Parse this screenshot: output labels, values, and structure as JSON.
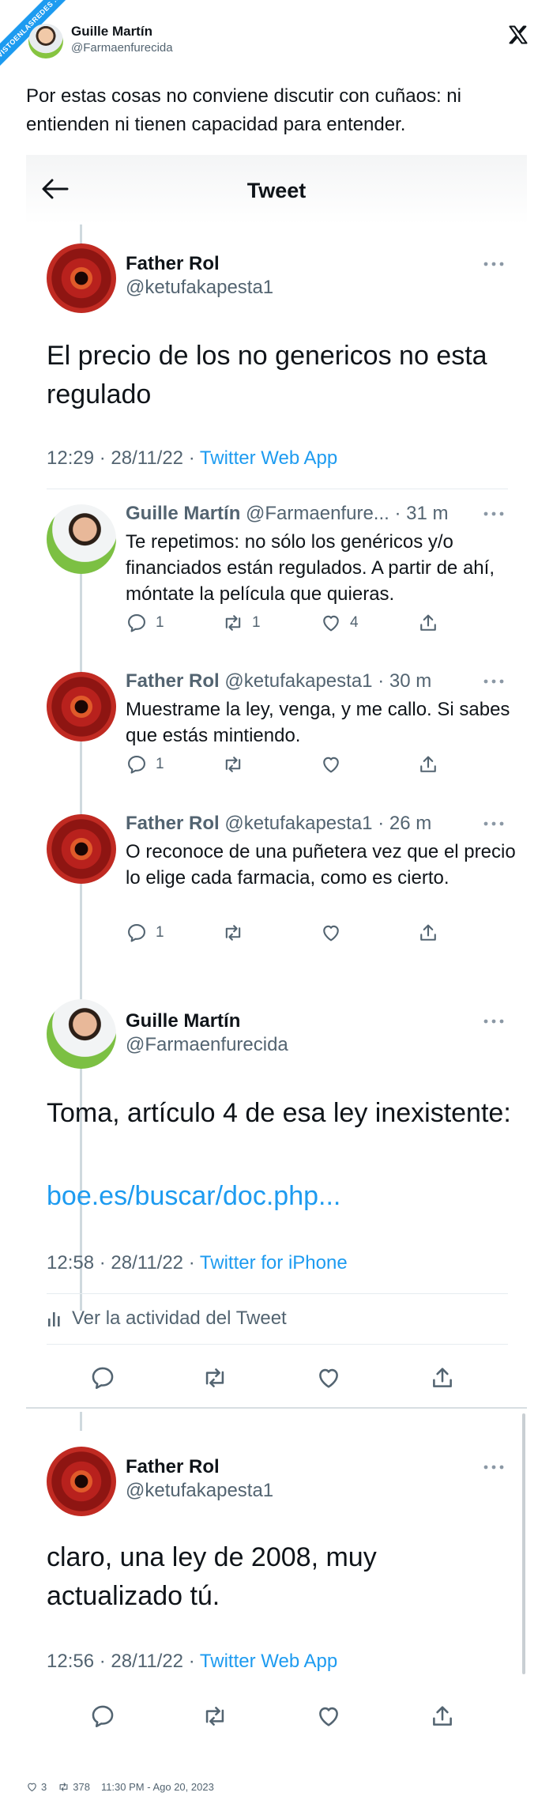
{
  "embed": {
    "ribbon_text": "VISTOENLASREDES .com",
    "author_name": "Guille Martín",
    "author_handle": "@Farmaenfurecida",
    "text": "Por estas cosas no conviene discutir con cuñaos: ni entienden ni tienen capacidad para entender.",
    "close_icon": "x-logo-icon"
  },
  "screenshot": {
    "header_title": "Tweet",
    "main_tweet": {
      "name": "Father Rol",
      "handle": "@ketufakapesta1",
      "text": "El precio de los no genericos no esta regulado",
      "time": "12:29 · 28/11/22 · ",
      "source": "Twitter Web App"
    },
    "replies": [
      {
        "name": "Guille Martín",
        "handle": "@Farmaenfure...",
        "age": "· 31 m",
        "text": "Te repetimos: no sólo los genéricos y/o financiados están regulados. A partir de ahí, móntate la película que quieras.",
        "reply_count": "1",
        "retweet_count": "1",
        "like_count": "4"
      },
      {
        "name": "Father Rol",
        "handle": "@ketufakapesta1",
        "age": "· 30 m",
        "text": "Muestrame la ley, venga, y me callo. Si sabes que estás mintiendo.",
        "reply_count": "1",
        "retweet_count": "",
        "like_count": ""
      },
      {
        "name": "Father Rol",
        "handle": "@ketufakapesta1",
        "age": "· 26 m",
        "text": "O reconoce de una puñetera vez que el precio lo elige cada farmacia, como es cierto.",
        "reply_count": "1",
        "retweet_count": "",
        "like_count": ""
      }
    ],
    "focus_tweet": {
      "name": "Guille Martín",
      "handle": "@Farmaenfurecida",
      "text": "Toma, artículo 4 de esa ley inexistente:",
      "link": "boe.es/buscar/doc.php...",
      "time": "12:58 · 28/11/22 · ",
      "source": "Twitter for iPhone",
      "activity_label": "Ver la actividad del Tweet"
    },
    "last_tweet": {
      "name": "Father Rol",
      "handle": "@ketufakapesta1",
      "text": "claro, una ley de 2008, muy actualizado tú.",
      "time": "12:56 · 28/11/22 · ",
      "source": "Twitter Web App"
    }
  },
  "footer": {
    "likes": "3",
    "retweets": "378",
    "timestamp": "11:30 PM - Ago 20, 2023"
  },
  "colors": {
    "accent": "#1d9bf0",
    "text": "#0f1419",
    "muted": "#536471"
  }
}
